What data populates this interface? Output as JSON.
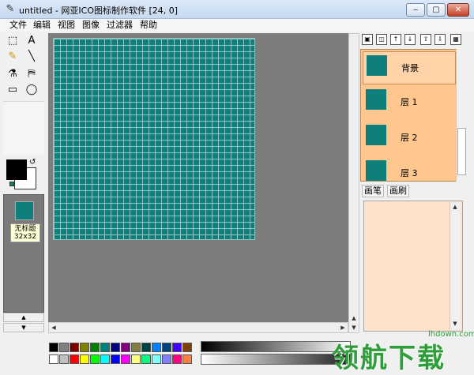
{
  "window": {
    "title": "untitled - 网亚ICO图标制作软件 [24, 0]",
    "controls": [
      "‒",
      "▢",
      "✕"
    ]
  },
  "menu": [
    "文件",
    "编辑",
    "视图",
    "图像",
    "过滤器",
    "帮助"
  ],
  "tools": [
    {
      "name": "select-rect-tool",
      "glyph": "⬚"
    },
    {
      "name": "text-tool",
      "glyph": "A"
    },
    {
      "name": "pencil-tool",
      "glyph": "✎"
    },
    {
      "name": "line-tool",
      "glyph": "╲"
    },
    {
      "name": "eyedropper-tool",
      "glyph": "⚗"
    },
    {
      "name": "fill-tool",
      "glyph": "⛿"
    },
    {
      "name": "rectangle-tool",
      "glyph": "▭"
    },
    {
      "name": "ellipse-tool",
      "glyph": "◯"
    }
  ],
  "colors": {
    "foreground": "#000000",
    "background": "#ffffff",
    "teal": "#0e7f7b",
    "swap_glyph": "↺"
  },
  "thumbnail": {
    "name": "无标题",
    "size": "32x32"
  },
  "layers": [
    {
      "name": "背景",
      "selected": true
    },
    {
      "name": "层 1",
      "selected": false
    },
    {
      "name": "层 2",
      "selected": false
    },
    {
      "name": "层 3",
      "selected": false
    }
  ],
  "layer_toolbar": [
    "▣",
    "◫",
    "↑",
    "↓",
    "⇧",
    "⇩",
    "▦"
  ],
  "tabs": [
    "画笔",
    "画刷"
  ],
  "scroll_glyphs": {
    "up": "▲",
    "down": "▼",
    "left": "◀",
    "right": "▶"
  },
  "palette": [
    "#000000",
    "#808080",
    "#800000",
    "#808000",
    "#008000",
    "#008080",
    "#000080",
    "#800080",
    "#808040",
    "#004040",
    "#0080ff",
    "#004080",
    "#4000ff",
    "#804000",
    "#ffffff",
    "#c0c0c0",
    "#ff0000",
    "#ffff00",
    "#00ff00",
    "#00ffff",
    "#0000ff",
    "#ff00ff",
    "#ffff80",
    "#00ff80",
    "#80ffff",
    "#8080ff",
    "#ff0080",
    "#ff8040"
  ],
  "watermark": {
    "text": "领航下载",
    "url": "lhdown.com"
  }
}
